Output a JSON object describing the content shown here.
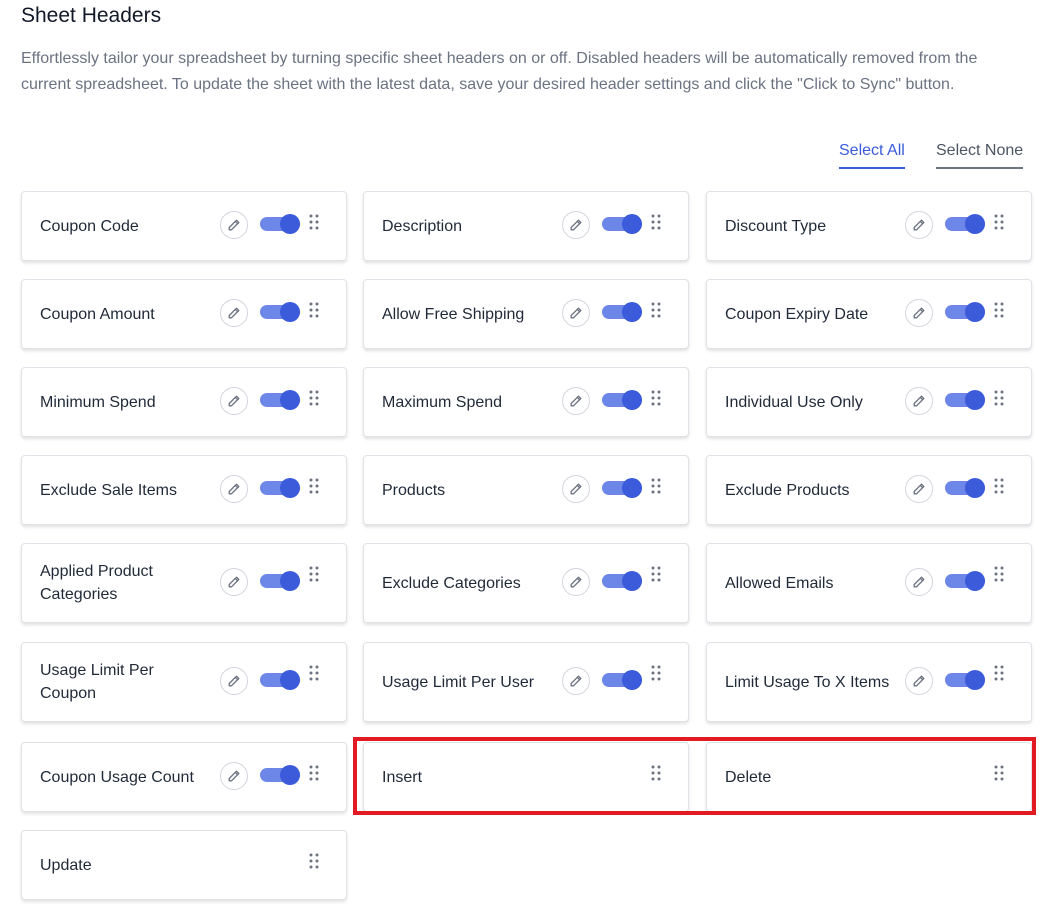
{
  "title": "Sheet Headers",
  "description": "Effortlessly tailor your spreadsheet by turning specific sheet headers on or off. Disabled headers will be automatically removed from the current spreadsheet. To update the sheet with the latest data, save your desired header settings and click the \"Click to Sync\" button.",
  "select_all": "Select All",
  "select_none": "Select None",
  "colors": {
    "accent": "#3b5bdb",
    "toggle_track": "#6d87e8",
    "highlight": "#e21b23"
  },
  "headers": [
    {
      "label": "Coupon Code",
      "enabled": true
    },
    {
      "label": "Description",
      "enabled": true
    },
    {
      "label": "Discount Type",
      "enabled": true
    },
    {
      "label": "Coupon Amount",
      "enabled": true
    },
    {
      "label": "Allow Free Shipping",
      "enabled": true
    },
    {
      "label": "Coupon Expiry Date",
      "enabled": true
    },
    {
      "label": "Minimum Spend",
      "enabled": true
    },
    {
      "label": "Maximum Spend",
      "enabled": true
    },
    {
      "label": "Individual Use Only",
      "enabled": true
    },
    {
      "label": "Exclude Sale Items",
      "enabled": true
    },
    {
      "label": "Products",
      "enabled": true
    },
    {
      "label": "Exclude Products",
      "enabled": true
    },
    {
      "label": "Applied Product Categories",
      "enabled": true
    },
    {
      "label": "Exclude Categories",
      "enabled": true
    },
    {
      "label": "Allowed Emails",
      "enabled": true
    },
    {
      "label": "Usage Limit Per Coupon",
      "enabled": true
    },
    {
      "label": "Usage Limit Per User",
      "enabled": true
    },
    {
      "label": "Limit Usage To X Items",
      "enabled": true
    },
    {
      "label": "Coupon Usage Count",
      "enabled": true
    },
    {
      "label": "Insert",
      "enabled": null
    },
    {
      "label": "Delete",
      "enabled": null
    },
    {
      "label": "Update",
      "enabled": null
    }
  ]
}
